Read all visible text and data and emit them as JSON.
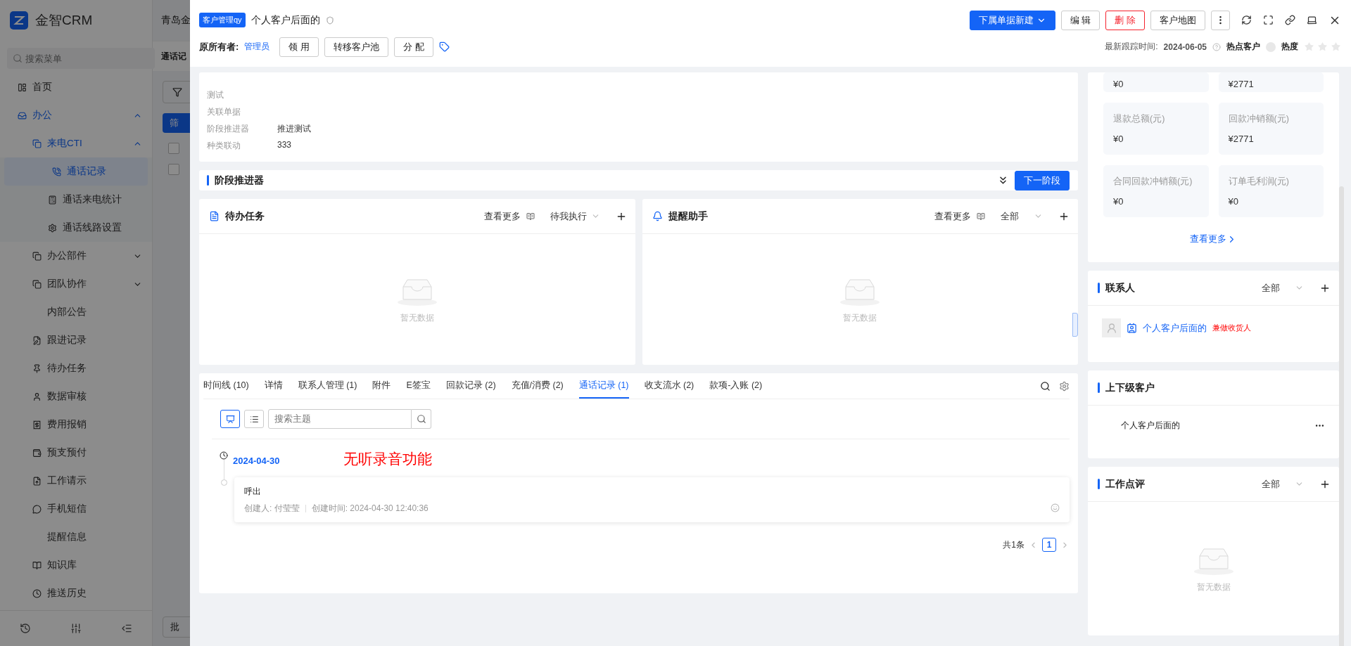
{
  "sidebar": {
    "logo": "金智CRM",
    "search": {
      "placeholder": "搜索菜单"
    },
    "items": [
      {
        "label": "首页",
        "selected": false
      },
      {
        "label": "办公",
        "selected": false,
        "expanded": true,
        "children": [
          {
            "label": "来电CTI",
            "selected": false,
            "expanded": true,
            "children": [
              {
                "label": "通话记录",
                "selected": true
              },
              {
                "label": "通话来电统计",
                "selected": false
              },
              {
                "label": "通话线路设置",
                "selected": false
              }
            ]
          },
          {
            "label": "办公部件",
            "selected": false,
            "expanded": false
          },
          {
            "label": "团队协作",
            "selected": false,
            "expanded": false
          },
          {
            "label": "内部公告",
            "selected": false
          },
          {
            "label": "跟进记录",
            "selected": false
          },
          {
            "label": "待办任务",
            "selected": false
          },
          {
            "label": "数据审核",
            "selected": false
          },
          {
            "label": "费用报销",
            "selected": false
          },
          {
            "label": "预支预付",
            "selected": false
          },
          {
            "label": "工作请示",
            "selected": false
          },
          {
            "label": "手机短信",
            "selected": false
          },
          {
            "label": "提醒信息",
            "selected": false
          },
          {
            "label": "知识库",
            "selected": false
          },
          {
            "label": "推送历史",
            "selected": false
          }
        ]
      }
    ]
  },
  "background_page": {
    "title": "青岛金",
    "tab": "通话记",
    "filter_button": "筛",
    "rows": [
      {
        "checked": false
      },
      {
        "checked": false
      }
    ],
    "batch_button": "批"
  },
  "header": {
    "tag": "客户管理qy",
    "title": "个人客户后面的",
    "owner_label": "原所有者:",
    "owner": "管理员",
    "actions": [
      "领 用",
      "转移客户池",
      "分 配"
    ],
    "buttons": [
      {
        "kind": "primary",
        "label": "下属单据新建"
      },
      {
        "kind": "default",
        "label": "编 辑"
      },
      {
        "kind": "danger",
        "label": "删 除"
      },
      {
        "kind": "default",
        "label": "客户地图"
      }
    ],
    "last_follow_label": "最新跟踪时间:",
    "last_follow": "2024-06-05",
    "hot_customer": {
      "label": "热点客户",
      "on": false
    },
    "heat": {
      "label": "热度",
      "stars": 0
    }
  },
  "info_rows": [
    {
      "label": "测试"
    },
    {
      "label": "关联单据"
    },
    {
      "label": "阶段推进器",
      "value": "推进测试"
    },
    {
      "label": "种类联动",
      "value": "333"
    }
  ],
  "stage_bar": {
    "title": "阶段推进器",
    "button": "下一阶段"
  },
  "panels": [
    {
      "kind": "task",
      "title": "待办任务",
      "more": "查看更多",
      "filter": "待我执行",
      "empty": "暂无数据"
    },
    {
      "kind": "reminder",
      "title": "提醒助手",
      "more": "查看更多",
      "filter": "全部",
      "empty": "暂无数据"
    }
  ],
  "tabs": [
    {
      "label": "时间线 (10)",
      "selected": false
    },
    {
      "label": "详情",
      "selected": false
    },
    {
      "label": "联系人管理 (1)",
      "selected": false
    },
    {
      "label": "附件",
      "selected": false
    },
    {
      "label": "E签宝",
      "selected": false
    },
    {
      "label": "回款记录 (2)",
      "selected": false
    },
    {
      "label": "充值/消费 (2)",
      "selected": false
    },
    {
      "label": "通话记录 (1)",
      "selected": true
    },
    {
      "label": "收支流水 (2)",
      "selected": false
    },
    {
      "label": "款项-入账 (2)",
      "selected": false
    }
  ],
  "call_log": {
    "view_modes": [
      {
        "kind": "card",
        "selected": true
      },
      {
        "kind": "list",
        "selected": false
      }
    ],
    "search": {
      "placeholder": "搜索主题"
    },
    "date": "2024-04-30",
    "note": "无听录音功能",
    "entries": [
      {
        "title": "呼出",
        "creator": "创建人: 付莹莹",
        "created": "创建时间: 2024-04-30 12:40:36"
      }
    ],
    "pagination": {
      "total": "共1条",
      "pages": [
        {
          "label": "1",
          "selected": true
        }
      ]
    }
  },
  "stats": [
    {
      "value": "¥0"
    },
    {
      "value": "¥2771"
    },
    {
      "label": "退款总额(元)",
      "value": "¥0"
    },
    {
      "label": "回款冲销额(元)",
      "value": "¥2771"
    },
    {
      "label": "合同回款冲销额(元)",
      "value": "¥0"
    },
    {
      "label": "订单毛利润(元)",
      "value": "¥0"
    }
  ],
  "stats_more": "查看更多",
  "contacts": {
    "title": "联系人",
    "filter": "全部",
    "items": [
      {
        "name": "个人客户后面的",
        "tag": "兼做收货人"
      }
    ]
  },
  "related": {
    "title": "上下级客户",
    "items": [
      {
        "name": "个人客户后面的"
      }
    ]
  },
  "reviews": {
    "title": "工作点评",
    "filter": "全部",
    "empty": "暂无数据"
  }
}
